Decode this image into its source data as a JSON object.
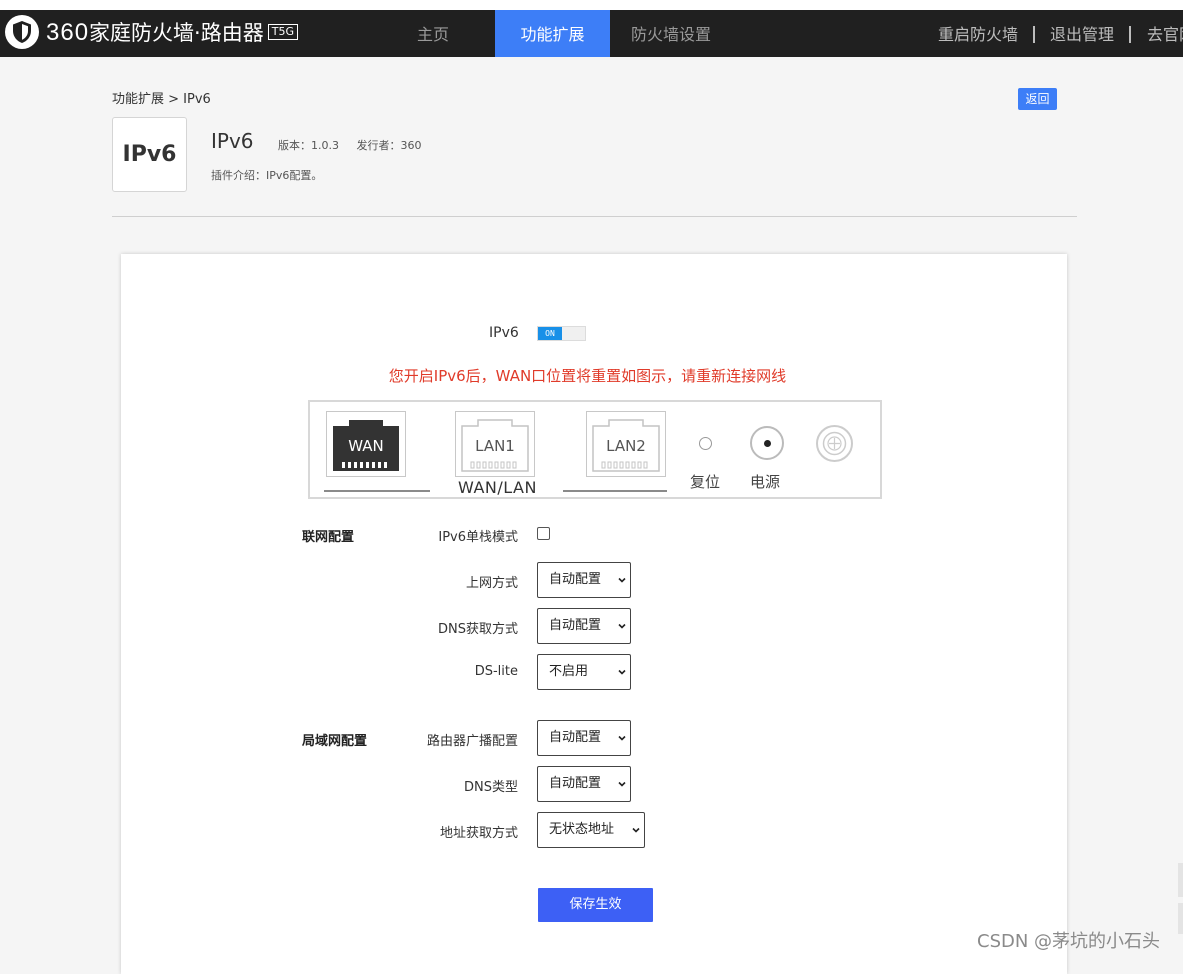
{
  "navbar": {
    "brand": "360",
    "brand_text": "家庭防火墙·路由器",
    "model": "T5G",
    "tabs": [
      "主页",
      "功能扩展",
      "防火墙设置"
    ],
    "active_tab": "功能扩展",
    "right_links": [
      "重启防火墙",
      "退出管理",
      "去官网"
    ]
  },
  "breadcrumb": "功能扩展 > IPv6",
  "back_button": "返回",
  "plugin": {
    "icon_text": "IPv6",
    "name": "IPv6",
    "version": "版本：1.0.3",
    "publisher": "发行者：360",
    "description": "插件介绍：IPv6配置。"
  },
  "toggle": {
    "label": "IPv6",
    "state": "ON"
  },
  "warning": "您开启IPv6后，WAN口位置将重置如图示，请重新连接网线",
  "panel": {
    "ports": [
      "WAN",
      "LAN1",
      "LAN2"
    ],
    "group_label": "WAN/LAN",
    "reset_label": "复位",
    "power_label": "电源"
  },
  "sections": {
    "wan": "联网配置",
    "lan": "局域网配置"
  },
  "fields": {
    "single_stack": {
      "label": "IPv6单栈模式",
      "checked": false
    },
    "conn_type": {
      "label": "上网方式",
      "value": "自动配置"
    },
    "dns_method": {
      "label": "DNS获取方式",
      "value": "自动配置"
    },
    "ds_lite": {
      "label": "DS-lite",
      "value": "不启用"
    },
    "router_adv": {
      "label": "路由器广播配置",
      "value": "自动配置"
    },
    "dns_type": {
      "label": "DNS类型",
      "value": "自动配置"
    },
    "addr_method": {
      "label": "地址获取方式",
      "value": "无状态地址"
    }
  },
  "save_button": "保存生效",
  "watermark": "CSDN @茅坑的小石头",
  "colors": {
    "nav_bg": "#202020",
    "accent": "#3d7ef7",
    "save_button": "#3d60f5",
    "warning": "#e03b2a",
    "toggle_on": "#1890e8"
  }
}
